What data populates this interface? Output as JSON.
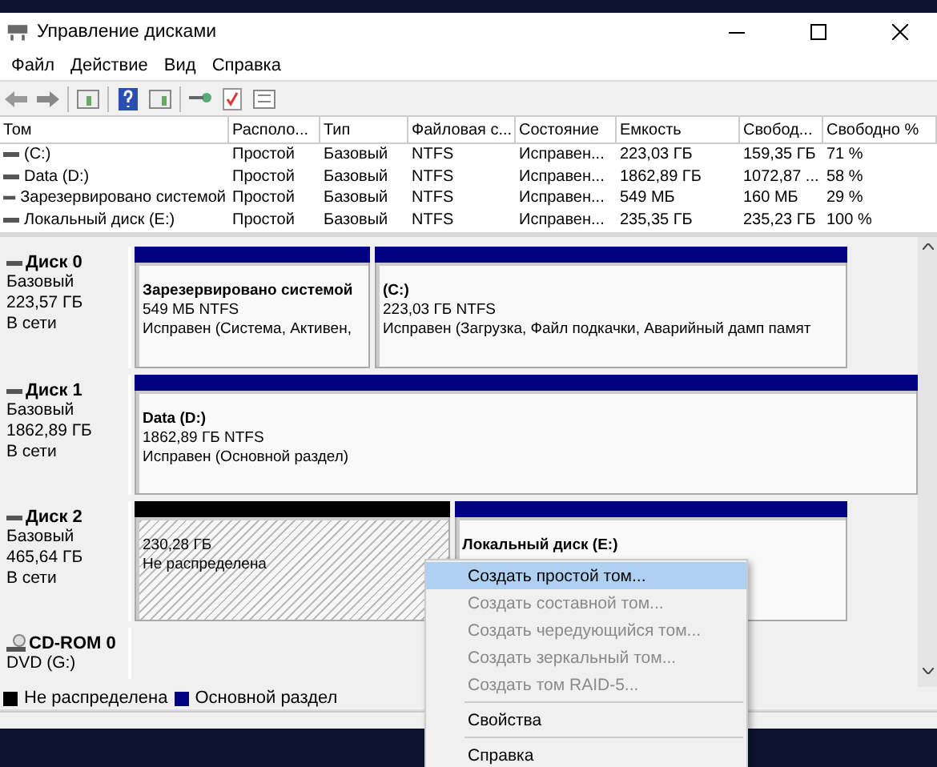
{
  "window": {
    "title": "Управление дисками"
  },
  "menu": [
    "Файл",
    "Действие",
    "Вид",
    "Справка"
  ],
  "table": {
    "columns": [
      "Том",
      "Располо...",
      "Тип",
      "Файловая с...",
      "Состояние",
      "Емкость",
      "Свобод...",
      "Свободно %"
    ],
    "rows": [
      [
        "(C:)",
        "Простой",
        "Базовый",
        "NTFS",
        "Исправен...",
        "223,03 ГБ",
        "159,35 ГБ",
        "71 %"
      ],
      [
        "Data (D:)",
        "Простой",
        "Базовый",
        "NTFS",
        "Исправен...",
        "1862,89 ГБ",
        "1072,87 ...",
        "58 %"
      ],
      [
        "Зарезервировано системой",
        "Простой",
        "Базовый",
        "NTFS",
        "Исправен...",
        "549 МБ",
        "160 МБ",
        "29 %"
      ],
      [
        "Локальный диск (E:)",
        "Простой",
        "Базовый",
        "NTFS",
        "Исправен...",
        "235,35 ГБ",
        "235,23 ГБ",
        "100 %"
      ]
    ]
  },
  "disks": [
    {
      "name": "Диск 0",
      "type": "Базовый",
      "size": "223,57 ГБ",
      "status": "В сети",
      "partitions": [
        {
          "kind": "primary",
          "title": "Зарезервировано системой",
          "size": "549 МБ NTFS",
          "status": "Исправен (Система, Активен,"
        },
        {
          "kind": "primary",
          "title": "(C:)",
          "size": "223,03 ГБ NTFS",
          "status": "Исправен (Загрузка, Файл подкачки, Аварийный дамп памят"
        }
      ]
    },
    {
      "name": "Диск 1",
      "type": "Базовый",
      "size": "1862,89 ГБ",
      "status": "В сети",
      "partitions": [
        {
          "kind": "primary",
          "title": "Data  (D:)",
          "size": "1862,89 ГБ NTFS",
          "status": "Исправен (Основной раздел)"
        }
      ]
    },
    {
      "name": "Диск 2",
      "type": "Базовый",
      "size": "465,64 ГБ",
      "status": "В сети",
      "partitions": [
        {
          "kind": "unallocated",
          "size": "230,28 ГБ",
          "status": "Не распределена"
        },
        {
          "kind": "primary",
          "title": "Локальный диск (E:)"
        }
      ]
    }
  ],
  "cdrom": {
    "name": "CD-ROM 0",
    "drive": "DVD (G:)"
  },
  "legend": [
    {
      "label": "Не распределена",
      "color": "#000000"
    },
    {
      "label": "Основной раздел",
      "color": "#000080"
    }
  ],
  "context_menu": {
    "groups": [
      [
        {
          "label": "Создать простой том...",
          "disabled": false,
          "selected": true
        },
        {
          "label": "Создать составной том...",
          "disabled": true,
          "selected": false
        },
        {
          "label": "Создать чередующийся том...",
          "disabled": true,
          "selected": false
        },
        {
          "label": "Создать зеркальный том...",
          "disabled": true,
          "selected": false
        },
        {
          "label": "Создать том RAID-5...",
          "disabled": true,
          "selected": false
        }
      ],
      [
        {
          "label": "Свойства",
          "disabled": false,
          "selected": false
        }
      ],
      [
        {
          "label": "Справка",
          "disabled": false,
          "selected": false
        }
      ]
    ]
  }
}
